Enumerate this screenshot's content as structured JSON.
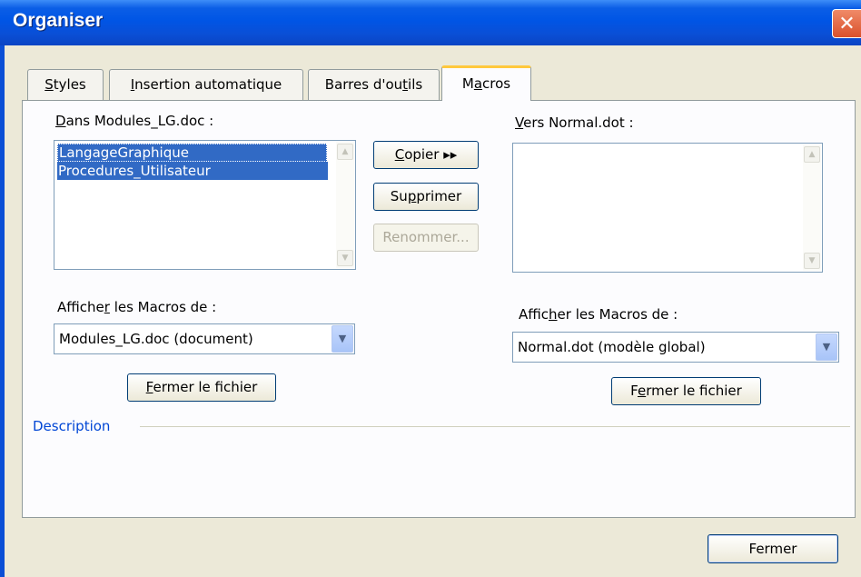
{
  "window": {
    "title": "Organiser"
  },
  "tabs": [
    {
      "pre": "",
      "key": "S",
      "post": "tyles"
    },
    {
      "pre": "",
      "key": "I",
      "post": "nsertion automatique"
    },
    {
      "pre": "Barres d'ou",
      "key": "t",
      "post": "ils"
    },
    {
      "pre": "M",
      "key": "a",
      "post": "cros"
    }
  ],
  "left": {
    "label_key": "D",
    "label_rest": "ans Modules_LG.doc :",
    "items": [
      "LangageGraphique",
      "Procedures_Utilisateur"
    ],
    "show_label_pre": "Affiche",
    "show_label_key": "r",
    "show_label_post": " les Macros de :",
    "combo_value": "Modules_LG.doc (document)",
    "close_file_key": "F",
    "close_file_rest": "ermer le fichier"
  },
  "right": {
    "label_key": "V",
    "label_rest": "ers Normal.dot :",
    "show_label_pre": "Affic",
    "show_label_key": "h",
    "show_label_post": "er les Macros de :",
    "combo_value": "Normal.dot (modèle global)",
    "close_file_pre": "F",
    "close_file_key": "e",
    "close_file_post": "rmer le fichier"
  },
  "center": {
    "copy_key": "C",
    "copy_rest": "opier ▸▸",
    "delete_pre": "Su",
    "delete_key": "p",
    "delete_post": "primer",
    "rename_label": "Renommer..."
  },
  "description_label": "Description",
  "footer": {
    "close_label": "Fermer"
  },
  "colors": {
    "title_bar": "#0055e5",
    "selection": "#316ac5",
    "active_tab_accent": "#ffc83c",
    "close_button": "#d9512c"
  },
  "icons": [
    "close-icon",
    "scroll-up-icon",
    "scroll-down-icon",
    "chevron-down-icon"
  ]
}
